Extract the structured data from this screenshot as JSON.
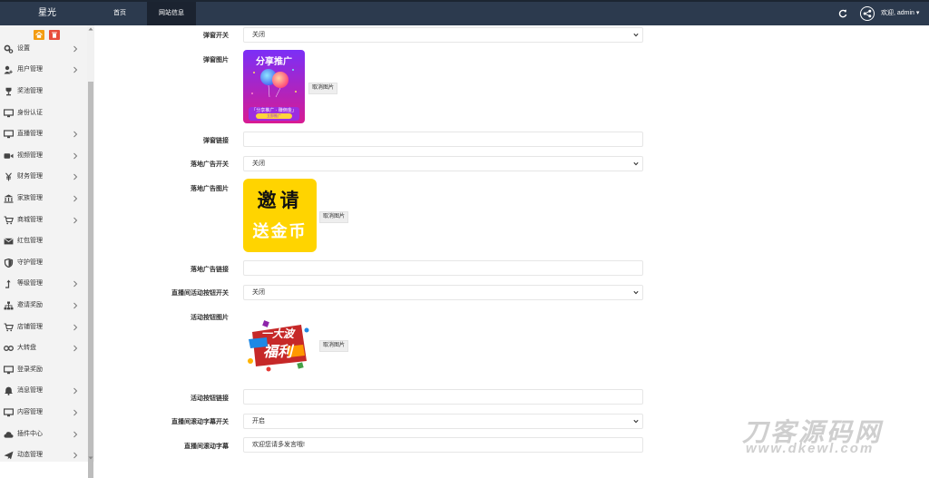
{
  "app": {
    "brand": "星光"
  },
  "nav": {
    "tabs": [
      {
        "label": "首页"
      },
      {
        "label": "网站信息"
      }
    ]
  },
  "header": {
    "welcome": "欢迎, admin ▾"
  },
  "sidebar": {
    "items": [
      {
        "label": "设置",
        "icon": "gear-icon"
      },
      {
        "label": "用户管理",
        "icon": "user-icon"
      },
      {
        "label": "奖池管理",
        "icon": "trophy-icon"
      },
      {
        "label": "身份认证",
        "icon": "monitor-icon"
      },
      {
        "label": "直播管理",
        "icon": "monitor-icon"
      },
      {
        "label": "视频管理",
        "icon": "video-camera-icon"
      },
      {
        "label": "财务管理",
        "icon": "yen-icon"
      },
      {
        "label": "家族管理",
        "icon": "bank-icon"
      },
      {
        "label": "商城管理",
        "icon": "cart-icon"
      },
      {
        "label": "红包管理",
        "icon": "envelope-icon"
      },
      {
        "label": "守护管理",
        "icon": "shield-icon"
      },
      {
        "label": "等级管理",
        "icon": "level-up-icon"
      },
      {
        "label": "邀请奖励",
        "icon": "sitemap-icon"
      },
      {
        "label": "店铺管理",
        "icon": "cart-icon"
      },
      {
        "label": "大转盘",
        "icon": "eye-mask-icon"
      },
      {
        "label": "登录奖励",
        "icon": "monitor-icon"
      },
      {
        "label": "消息管理",
        "icon": "bell-icon"
      },
      {
        "label": "内容管理",
        "icon": "monitor-icon"
      },
      {
        "label": "插件中心",
        "icon": "cloud-icon"
      },
      {
        "label": "动态管理",
        "icon": "paper-plane-icon"
      }
    ]
  },
  "form": {
    "popup_switch": {
      "label": "弹窗开关",
      "value": "关闭"
    },
    "popup_image": {
      "label": "弹窗图片",
      "cancel": "取消图片",
      "title": "分享推广",
      "caption": "「分享推广 · 赚佣金」",
      "button": "立即推广"
    },
    "popup_link": {
      "label": "弹窗链接",
      "value": ""
    },
    "landing_switch": {
      "label": "落地广告开关",
      "value": "关闭"
    },
    "landing_image": {
      "label": "落地广告图片",
      "cancel": "取消图片",
      "line1": "邀请",
      "line2": "送金币"
    },
    "landing_link": {
      "label": "落地广告链接",
      "value": ""
    },
    "activity_switch": {
      "label": "直播间活动按钮开关",
      "value": "关闭"
    },
    "activity_image": {
      "label": "活动按钮图片",
      "cancel": "取消图片",
      "line1": "一大波",
      "line2": "福利"
    },
    "activity_link": {
      "label": "活动按钮链接",
      "value": ""
    },
    "marquee_switch": {
      "label": "直播间滚动字幕开关",
      "value": "开启"
    },
    "marquee_text": {
      "label": "直播间滚动字幕",
      "value": "欢迎您请多发言哦!"
    }
  },
  "watermark": {
    "line1": "刀客源码网",
    "line2": "www.dkewl.com"
  },
  "colors": {
    "topbar": "#2c3a4e",
    "home_button": "#f39c12",
    "delete_button": "#e74c3c",
    "popup_purple": "#8e24d8",
    "landing_yellow": "#ffd400"
  }
}
